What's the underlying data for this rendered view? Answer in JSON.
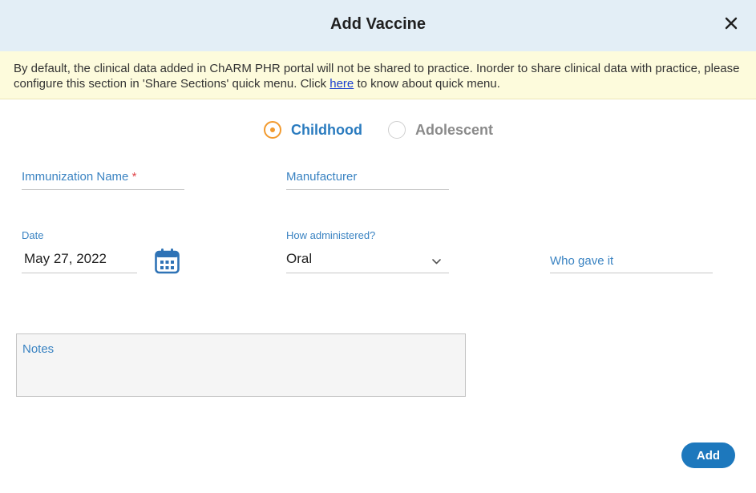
{
  "dialog": {
    "title": "Add Vaccine",
    "close_icon": "close-icon"
  },
  "notice": {
    "text_before": "By default, the clinical data added in ChARM PHR portal will not be shared to practice. Inorder to share clinical data with practice, please configure this section in 'Share Sections' quick menu. Click ",
    "link_text": "here",
    "text_after": " to know about quick menu."
  },
  "age_group": {
    "options": [
      "Childhood",
      "Adolescent"
    ],
    "selected": "Childhood"
  },
  "form": {
    "immunization_name": {
      "label": "Immunization Name",
      "required_mark": "*",
      "value": ""
    },
    "manufacturer": {
      "label": "Manufacturer",
      "value": ""
    },
    "date": {
      "label": "Date",
      "value": "May 27, 2022",
      "icon": "calendar-icon"
    },
    "how_administered": {
      "label": "How administered?",
      "value": "Oral",
      "icon": "chevron-down-icon"
    },
    "who_gave_it": {
      "label": "Who gave it",
      "value": ""
    },
    "notes": {
      "placeholder": "Notes",
      "value": ""
    }
  },
  "actions": {
    "add_label": "Add"
  },
  "colors": {
    "header_bg": "#e3eef6",
    "notice_bg": "#fdfbdc",
    "accent_blue": "#1d78bd",
    "radio_orange": "#f29a2e",
    "label_blue": "#3a83c2",
    "required_red": "#e0454a"
  }
}
